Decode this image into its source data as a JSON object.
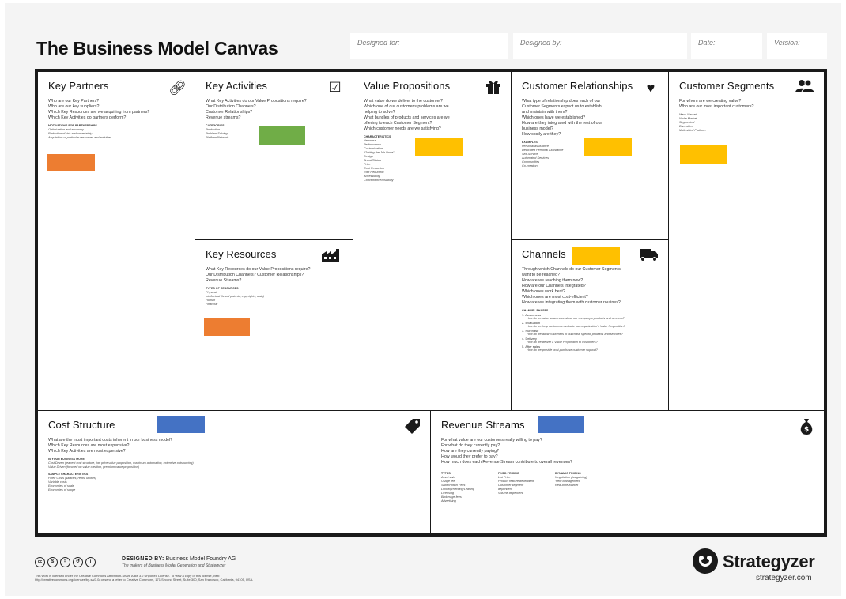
{
  "header": {
    "title": "The Business Model Canvas",
    "designed_for": "Designed for:",
    "designed_by": "Designed by:",
    "date": "Date:",
    "version": "Version:"
  },
  "blocks": {
    "key_partners": {
      "title": "Key Partners",
      "icon": "link-icon",
      "questions": [
        "Who are our Key Partners?",
        "Who are our key suppliers?",
        "Which Key Resources are we acquiring from partners?",
        "Which Key Activities do partners perform?"
      ],
      "subhead": "MOTIVATIONS FOR PARTNERSHIPS",
      "items": [
        "Optimization and economy",
        "Reduction of risk and uncertainty",
        "Acquisition of particular resources and activities"
      ]
    },
    "key_activities": {
      "title": "Key Activities",
      "icon": "checkbox-icon",
      "questions": [
        "What Key Activities do our Value Propositions require?",
        "Our Distribution Channels?",
        "Customer Relationships?",
        "Revenue streams?"
      ],
      "subhead": "CATEGORIES",
      "items": [
        "Production",
        "Problem Solving",
        "Platform/Network"
      ]
    },
    "key_resources": {
      "title": "Key Resources",
      "icon": "factory-icon",
      "questions": [
        "What Key Resources do our Value Propositions require?",
        "Our Distribution Channels? Customer Relationships?",
        "Revenue Streams?"
      ],
      "subhead": "TYPES OF RESOURCES",
      "items": [
        "Physical",
        "Intellectual (brand patents, copyrights, data)",
        "Human",
        "Financial"
      ]
    },
    "value_propositions": {
      "title": "Value Propositions",
      "icon": "gift-icon",
      "questions": [
        "What value do we deliver to the customer?",
        "Which one of our customer's problems are we",
        "helping to solve?",
        "What bundles of products and services are we",
        "offering to each Customer Segment?",
        "Which customer needs are we satisfying?"
      ],
      "subhead": "CHARACTERISTICS",
      "items": [
        "Newness",
        "Performance",
        "Customization",
        "\"Getting the Job Done\"",
        "Design",
        "Brand/Status",
        "Price",
        "Cost Reduction",
        "Risk Reduction",
        "Accessibility",
        "Convenience/Usability"
      ]
    },
    "customer_relationships": {
      "title": "Customer Relationships",
      "icon": "heart-icon",
      "questions": [
        "What type of relationship does each of our",
        "Customer Segments expect us to establish",
        "and maintain with them?",
        "Which ones have we established?",
        "How are they integrated with the rest of our",
        "business model?",
        "How costly are they?"
      ],
      "subhead": "EXAMPLES",
      "items": [
        "Personal assistance",
        "Dedicated Personal Assistance",
        "Self-Service",
        "Automated Services",
        "Communities",
        "Co-creation"
      ]
    },
    "channels": {
      "title": "Channels",
      "icon": "truck-icon",
      "questions": [
        "Through which Channels do our Customer Segments",
        "want to be reached?",
        "How are we reaching them now?",
        "How are our Channels integrated?",
        "Which ones work best?",
        "Which ones are most cost-efficient?",
        "How are we integrating them with customer routines?"
      ],
      "subhead": "CHANNEL PHASES",
      "phases": [
        {
          "name": "1. Awareness",
          "detail": "How do we raise awareness about our company's products and services?"
        },
        {
          "name": "2. Evaluation",
          "detail": "How do we help customers evaluate our organization's Value Proposition?"
        },
        {
          "name": "3. Purchase",
          "detail": "How do we allow customers to purchase specific products and services?"
        },
        {
          "name": "4. Delivery",
          "detail": "How do we deliver a Value Proposition to customers?"
        },
        {
          "name": "5. After sales",
          "detail": "How do we provide post-purchase customer support?"
        }
      ]
    },
    "customer_segments": {
      "title": "Customer Segments",
      "icon": "people-icon",
      "questions": [
        "For whom are we creating value?",
        "Who are our most important customers?"
      ],
      "items": [
        "Mass Market",
        "Niche Market",
        "Segmented",
        "Diversified",
        "Multi-sided Platform"
      ]
    },
    "cost_structure": {
      "title": "Cost Structure",
      "icon": "tag-icon",
      "questions": [
        "What are the most important costs inherent in our business model?",
        "Which Key Resources are most expensive?",
        "Which Key Activities are most expensive?"
      ],
      "subhead": "IS YOUR BUSINESS MORE",
      "items": [
        "Cost Driven (leanest cost structure, low price value proposition, maximum automation, extensive outsourcing)",
        "Value Driven (focused on value creation, premium value proposition)"
      ],
      "subhead2": "SAMPLE CHARACTERISTICS",
      "items2": [
        "Fixed Costs (salaries, rents, utilities)",
        "Variable costs",
        "Economies of scale",
        "Economies of scope"
      ]
    },
    "revenue_streams": {
      "title": "Revenue Streams",
      "icon": "money-bag-icon",
      "questions": [
        "For what value are our customers really willing to pay?",
        "For what do they currently pay?",
        "How are they currently paying?",
        "How would they prefer to pay?",
        "How much does each Revenue Stream contribute to overall revenues?"
      ],
      "col1_head": "TYPES",
      "col1": [
        "Asset sale",
        "Usage fee",
        "Subscription Fees",
        "Lending/Renting/Leasing",
        "Licensing",
        "Brokerage fees",
        "Advertising"
      ],
      "col2_head": "FIXED PRICING",
      "col2": [
        "List Price",
        "Product feature dependent",
        "Customer segment",
        "dependent",
        "Volume dependent"
      ],
      "col3_head": "DYNAMIC PRICING",
      "col3": [
        "Negotiation (bargaining)",
        "Yield Management",
        "Real-time-Market"
      ]
    }
  },
  "notes": {
    "orange": "#ed7d31",
    "green": "#70ad47",
    "yellow": "#ffc000",
    "blue": "#4472c4"
  },
  "footer": {
    "badges": [
      "cc",
      "$",
      "=",
      "↺",
      "i"
    ],
    "designed_by_label": "DESIGNED BY:",
    "designed_by_value": "Business Model Foundry AG",
    "makers": "The makers of Business Model Generation and Strategyzer",
    "license_1": "This work is licensed under the Creative Commons Attribution-Share Alike 3.0 Unported License. To view a copy of this license, visit:",
    "license_2": "http://creativecommons.org/licenses/by-sa/3.0/ or send a letter to Creative Commons, 171 Second Street, Suite 300, San Francisco, California, 94105, USA.",
    "logo": "Strategyzer",
    "url": "strategyzer.com"
  }
}
